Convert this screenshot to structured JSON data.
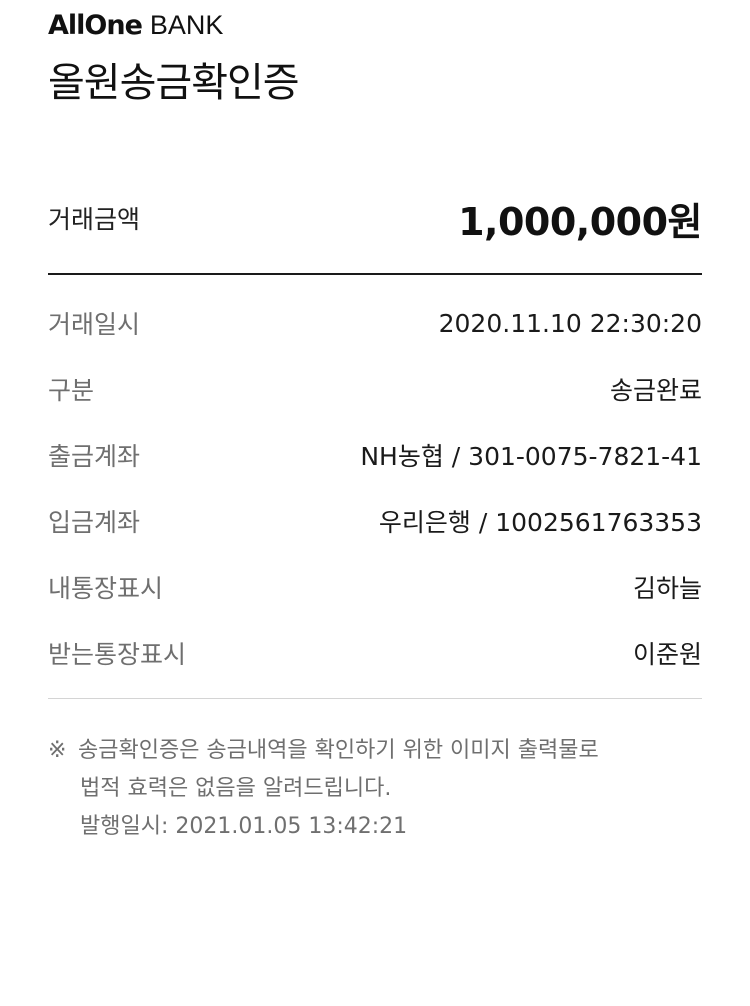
{
  "brand": {
    "logo_text": "AllOne",
    "suffix": "BANK"
  },
  "title": "올원송금확인증",
  "amount": {
    "label": "거래금액",
    "value": "1,000,000원"
  },
  "details": [
    {
      "label": "거래일시",
      "value": "2020.11.10 22:30:20"
    },
    {
      "label": "구분",
      "value": "송금완료"
    },
    {
      "label": "출금계좌",
      "value": "NH농협 / 301-0075-7821-41"
    },
    {
      "label": "입금계좌",
      "value": "우리은행 / 1002561763353"
    },
    {
      "label": "내통장표시",
      "value": "김하늘"
    },
    {
      "label": "받는통장표시",
      "value": "이준원"
    }
  ],
  "notice": {
    "mark": "※",
    "line1": "송금확인증은 송금내역을 확인하기 위한 이미지 출력물로",
    "line2": "법적 효력은 없음을 알려드립니다.",
    "line3": "발행일시: 2021.01.05 13:42:21"
  }
}
